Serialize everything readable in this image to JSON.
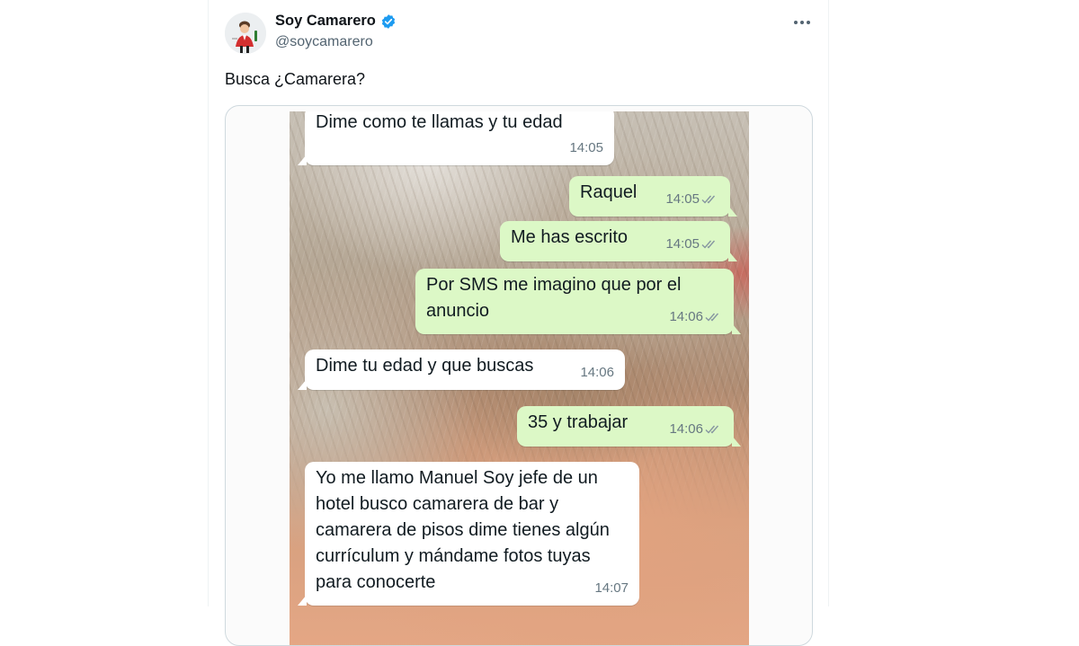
{
  "tweet": {
    "author_name": "Soy Camarero",
    "author_handle": "@soycamarero",
    "verified_icon": "verified-badge-icon",
    "more_icon": "more-options-icon",
    "text": "Busca ¿Camarera?"
  },
  "chat": {
    "messages": [
      {
        "direction": "incoming",
        "text": "Dime como te llamas y tu edad",
        "time": "14:05"
      },
      {
        "direction": "outgoing",
        "text": "Raquel",
        "time": "14:05",
        "status": "double-check-icon"
      },
      {
        "direction": "outgoing",
        "text": "Me has escrito",
        "time": "14:05",
        "status": "double-check-icon"
      },
      {
        "direction": "outgoing",
        "text": "Por SMS me imagino que por el anuncio",
        "time": "14:06",
        "status": "double-check-icon"
      },
      {
        "direction": "incoming",
        "text": "Dime tu edad y que buscas",
        "time": "14:06"
      },
      {
        "direction": "outgoing",
        "text": "35 y trabajar",
        "time": "14:06",
        "status": "double-check-icon"
      },
      {
        "direction": "incoming",
        "text": "Yo me llamo Manuel Soy jefe de un hotel busco camarera de bar y camarera de pisos dime tienes algún currículum y mándame fotos tuyas para conocerte",
        "time": "14:07"
      }
    ]
  },
  "colors": {
    "verified": "#1d9bf0",
    "outgoing_bubble": "#dcf8c6",
    "incoming_bubble": "#ffffff",
    "read_check": "#8696a0"
  }
}
